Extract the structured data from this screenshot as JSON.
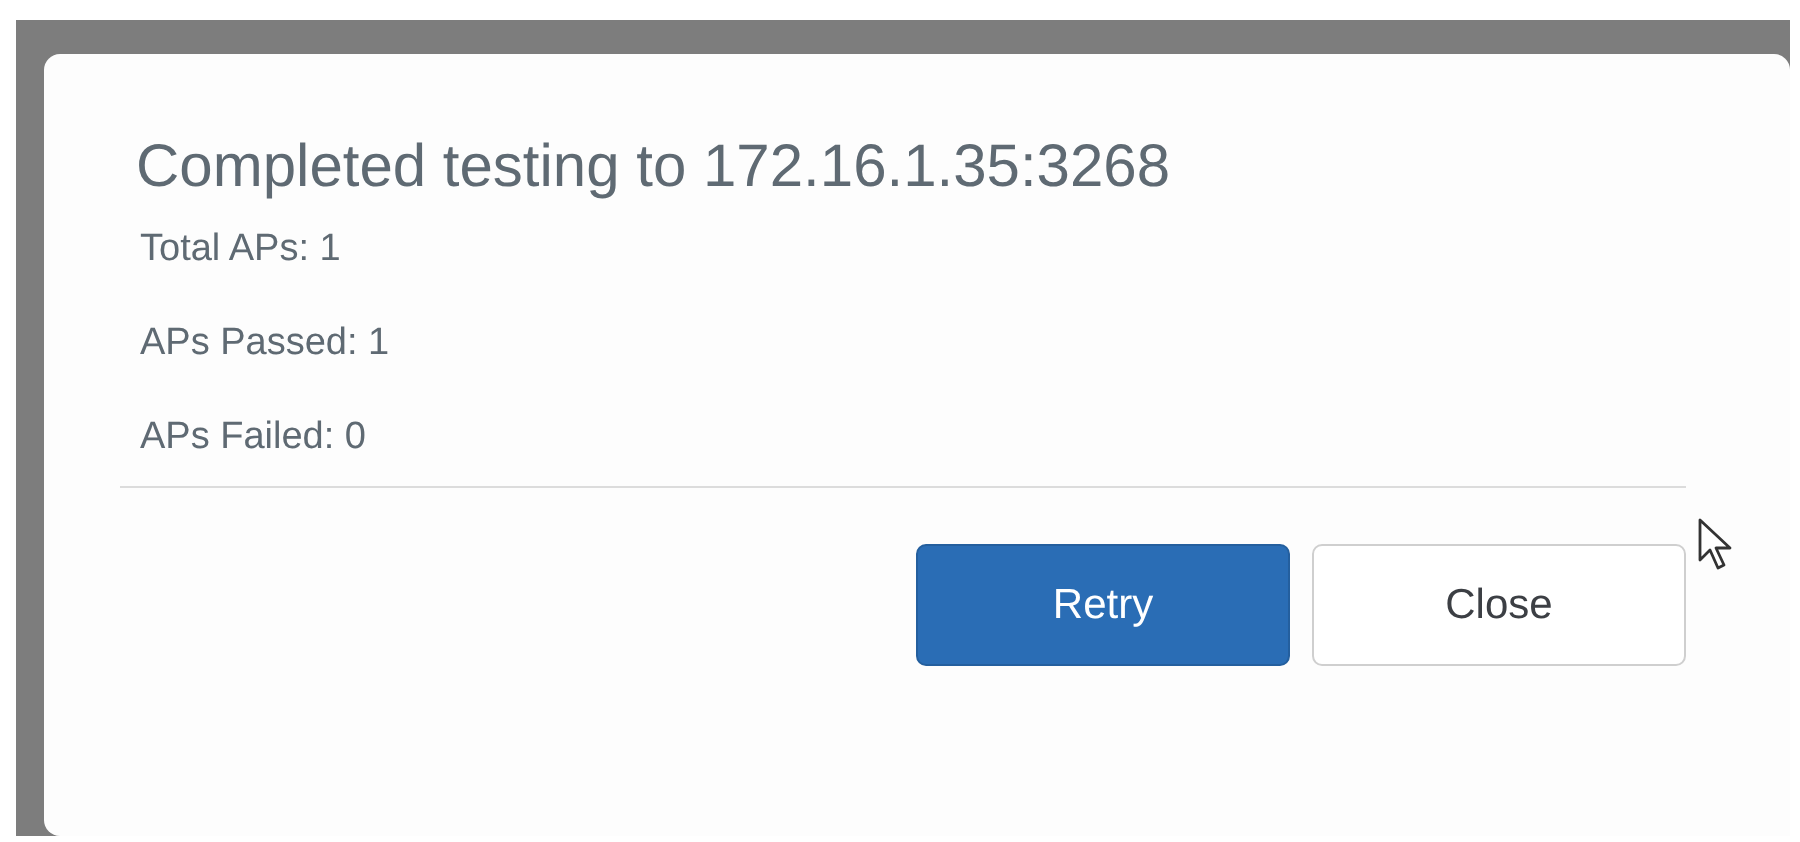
{
  "dialog": {
    "title": "Completed testing to 172.16.1.35:3268",
    "lines": [
      "Total APs: 1",
      "APs Passed: 1",
      "APs Failed: 0"
    ],
    "buttons": [
      {
        "label": "Retry",
        "kind": "primary"
      },
      {
        "label": "Close",
        "kind": "secondary"
      }
    ]
  }
}
